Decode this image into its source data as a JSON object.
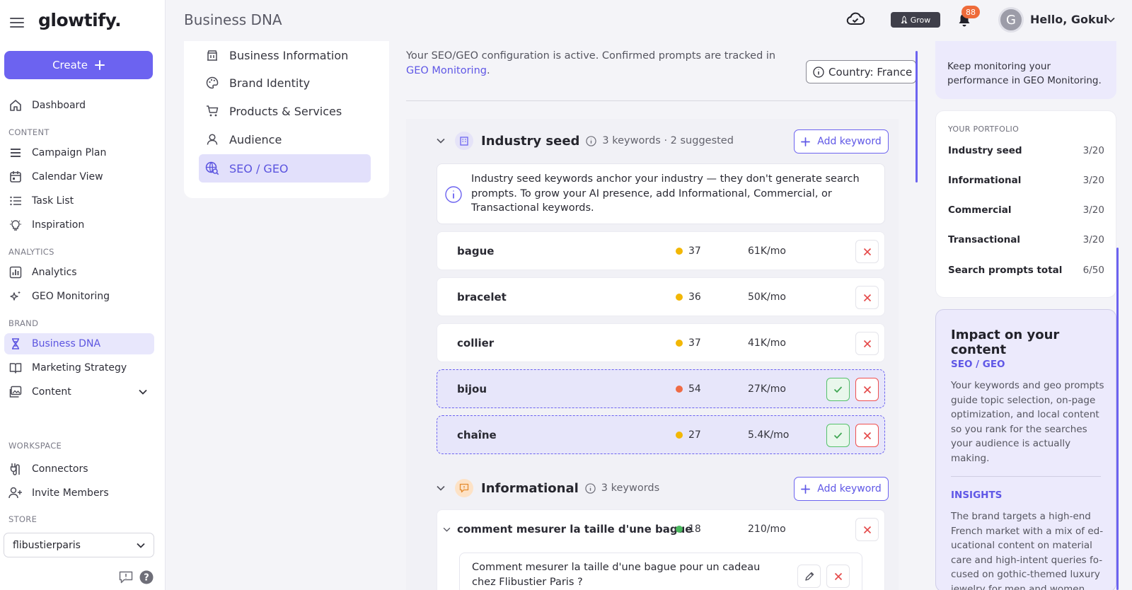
{
  "app": {
    "logo": "glowtify."
  },
  "sidebar": {
    "create_label": "Create",
    "items_top": [
      {
        "label": "Dashboard"
      }
    ],
    "content_label": "CONTENT",
    "content_items": [
      {
        "label": "Campaign Plan"
      },
      {
        "label": "Calendar View"
      },
      {
        "label": "Task List"
      },
      {
        "label": "Inspiration"
      }
    ],
    "analytics_label": "ANALYTICS",
    "analytics_items": [
      {
        "label": "Analytics"
      },
      {
        "label": "GEO Monitoring"
      }
    ],
    "brand_label": "BRAND",
    "brand_items": [
      {
        "label": "Business DNA"
      },
      {
        "label": "Marketing Strategy"
      },
      {
        "label": "Content"
      }
    ],
    "workspace_label": "WORKSPACE",
    "workspace_items": [
      {
        "label": "Connectors"
      },
      {
        "label": "Invite Members"
      }
    ],
    "store_label": "STORE",
    "store_value": "flibustierparis"
  },
  "header": {
    "title": "Business DNA",
    "grow_label": "Grow",
    "notif_count": "88",
    "avatar_letter": "G",
    "greeting": "Hello, Gokul"
  },
  "subnav": {
    "items": [
      {
        "label": "Business Information"
      },
      {
        "label": "Brand Identity"
      },
      {
        "label": "Products & Services"
      },
      {
        "label": "Audience"
      },
      {
        "label": "SEO / GEO"
      }
    ]
  },
  "main": {
    "status_text": "Your SEO/GEO configuration is active. Confirmed prompts are tracked in",
    "status_link": "GEO Monitoring",
    "status_end": ".",
    "country": "Country: France",
    "industry": {
      "title": "Industry seed",
      "meta": "3 keywords · 2 suggested",
      "add_label": "Add keyword",
      "info": "Industry seed keywords anchor your industry — they don't generate search prompts. To grow your AI presence, add Informational, Commercial, or Transactional keywords.",
      "keywords": [
        {
          "name": "bague",
          "score": "37",
          "volume": "61K/mo",
          "color": "#f2b705"
        },
        {
          "name": "bracelet",
          "score": "36",
          "volume": "50K/mo",
          "color": "#f2b705"
        },
        {
          "name": "collier",
          "score": "37",
          "volume": "41K/mo",
          "color": "#f2b705"
        },
        {
          "name": "bijou",
          "score": "54",
          "volume": "27K/mo",
          "color": "#ef6b45"
        },
        {
          "name": "chaîne",
          "score": "27",
          "volume": "5.4K/mo",
          "color": "#f2b705"
        }
      ]
    },
    "informational": {
      "title": "Informational",
      "meta": "3 keywords",
      "add_label": "Add keyword",
      "keyword": {
        "name": "comment mesurer la taille d'une bague",
        "score": "18",
        "volume": "210/mo",
        "color": "#4cb85f"
      },
      "prompt": "Comment mesurer la taille d'une bague pour un cadeau chez Flibustier Paris ?"
    }
  },
  "right": {
    "monitor_text": "Keep monitoring your performance in GEO Monitoring.",
    "portfolio_label": "YOUR PORTFOLIO",
    "portfolio": [
      {
        "name": "Industry seed",
        "value": "3/20"
      },
      {
        "name": "Informational",
        "value": "3/20"
      },
      {
        "name": "Commercial",
        "value": "3/20"
      },
      {
        "name": "Transactional",
        "value": "3/20"
      },
      {
        "name": "Search prompts total",
        "value": "6/50"
      }
    ],
    "impact_title": "Impact on your content",
    "seo_heading": "SEO / GEO",
    "seo_text": "Your keywords and geo prompts guide topic selection, on-page optimization, and local content so you rank for the searches your audience is actually making.",
    "insights_heading": "INSIGHTS",
    "insights_text": "The brand targets a high-end French market with a mix of ed-ucational content on material care and high-intent queries fo-cused on gothic-themed luxury jewelry for men and women."
  }
}
